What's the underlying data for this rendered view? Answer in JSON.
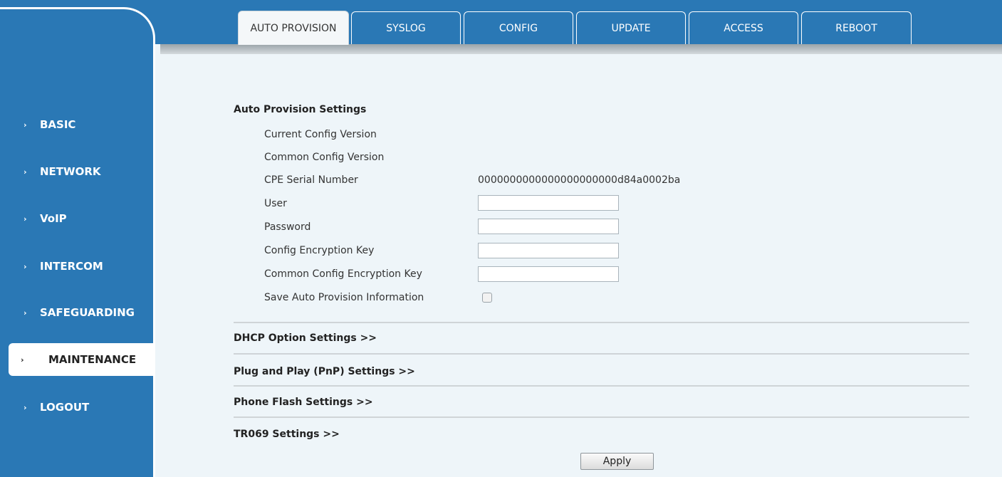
{
  "tabs": [
    {
      "label": "AUTO PROVISION",
      "active": true
    },
    {
      "label": "SYSLOG"
    },
    {
      "label": "CONFIG"
    },
    {
      "label": "UPDATE"
    },
    {
      "label": "ACCESS"
    },
    {
      "label": "REBOOT"
    }
  ],
  "sidebar": {
    "chevron": "›",
    "items": [
      {
        "label": "BASIC"
      },
      {
        "label": "NETWORK"
      },
      {
        "label": "VoIP"
      },
      {
        "label": "INTERCOM"
      },
      {
        "label": "SAFEGUARDING"
      },
      {
        "label": "MAINTENANCE",
        "active": true
      },
      {
        "label": "LOGOUT"
      }
    ]
  },
  "auto_provision": {
    "title": "Auto Provision Settings",
    "current_config_version_label": "Current Config Version",
    "common_config_version_label": "Common Config Version",
    "cpe_serial_label": "CPE Serial Number",
    "cpe_serial_value": "0000000000000000000000d84a0002ba",
    "user_label": "User",
    "user_value": "",
    "password_label": "Password",
    "password_value": "",
    "config_key_label": "Config Encryption Key",
    "config_key_value": "",
    "common_key_label": "Common Config Encryption Key",
    "common_key_value": "",
    "save_info_label": "Save Auto Provision Information",
    "save_info_checked": false
  },
  "sections": {
    "dhcp": "DHCP Option Settings >>",
    "pnp": "Plug and Play (PnP) Settings >>",
    "flash": "Phone Flash Settings >>",
    "tr069": "TR069 Settings >>"
  },
  "apply_label": "Apply",
  "colors": {
    "primary_blue": "#2a78b5",
    "content_bg": "#eef5f9"
  }
}
